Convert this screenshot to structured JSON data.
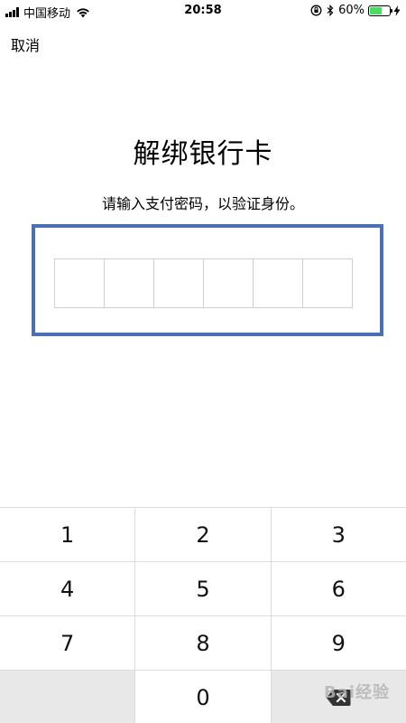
{
  "status_bar": {
    "carrier": "中国移动",
    "time": "20:58",
    "battery_percent": "60%",
    "battery_level": 0.6,
    "icons": [
      "signal-icon",
      "wifi-icon",
      "rotation-lock-icon",
      "bluetooth-icon",
      "battery-icon",
      "charging-icon"
    ]
  },
  "header": {
    "cancel_label": "取消"
  },
  "main": {
    "title": "解绑银行卡",
    "subtitle": "请输入支付密码，以验证身份。",
    "pin_length": 6,
    "highlight_color": "#4a6fb5"
  },
  "keypad": {
    "rows": [
      [
        "1",
        "2",
        "3"
      ],
      [
        "4",
        "5",
        "6"
      ],
      [
        "7",
        "8",
        "9"
      ],
      [
        "",
        "0",
        "delete"
      ]
    ]
  },
  "watermark": {
    "text": "Bai经验"
  }
}
